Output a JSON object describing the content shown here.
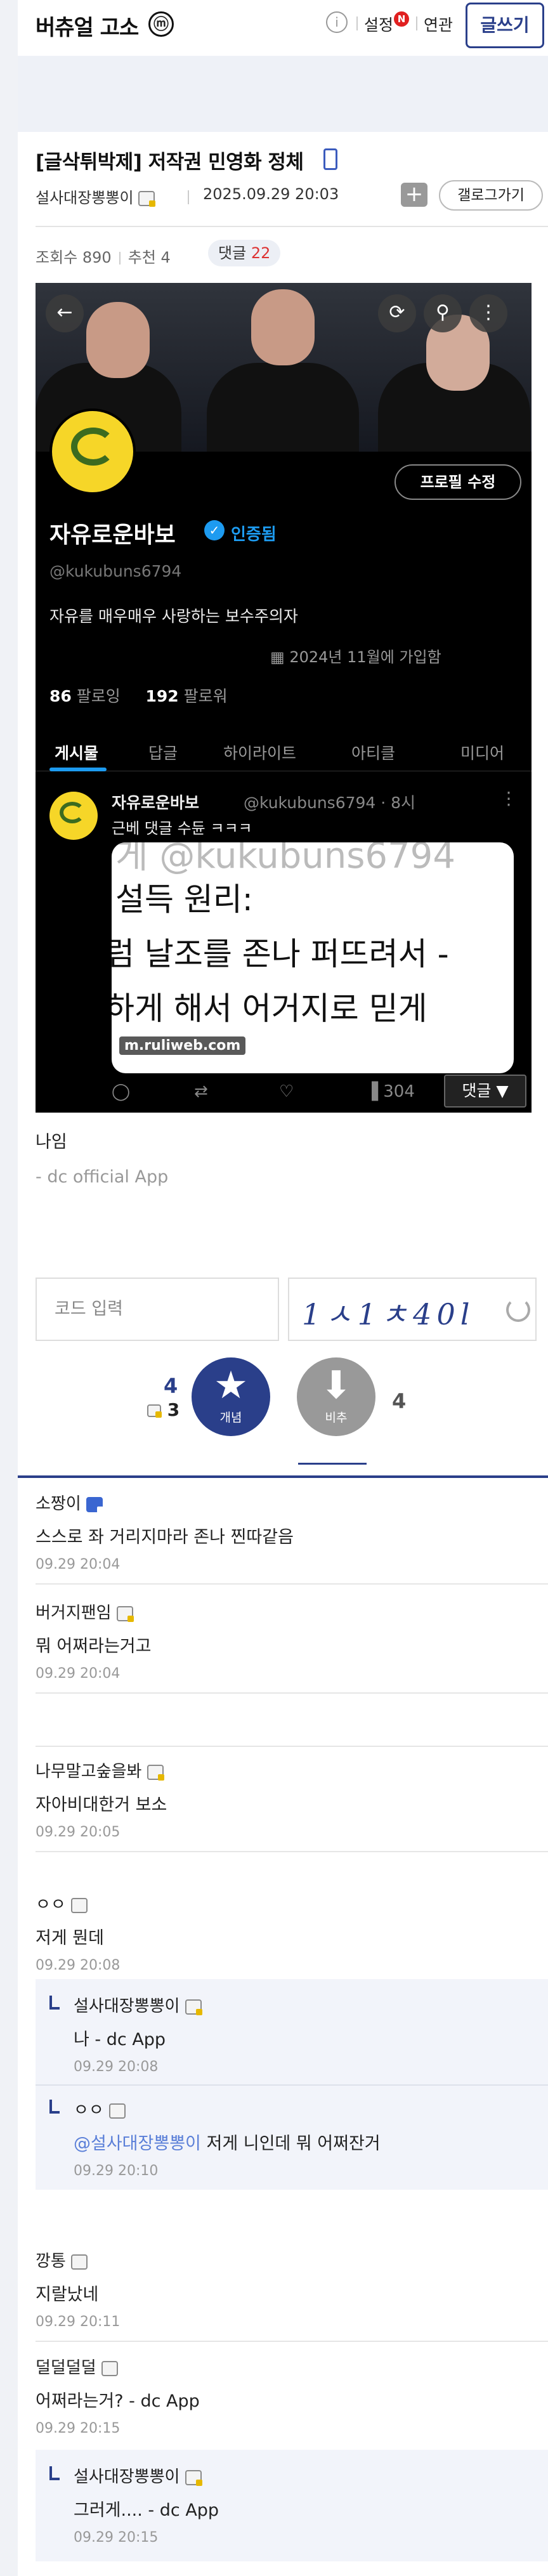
{
  "header": {
    "logo": "버츄얼 고소",
    "logo_badge": "ⓜ",
    "settings_label": "설정",
    "settings_badge": "N",
    "related_label": "연관",
    "write_button": "글쓰기"
  },
  "post": {
    "title": "[글삭튀박제] 저작권 민영화 정체",
    "author": "설사대장뽕뽕이",
    "date": "2025.09.29 20:03",
    "gallery_button": "갤로그가기",
    "views": "조회수 890",
    "recommends": "추천 4",
    "comments_label": "댓글",
    "comments_count": "22",
    "body_line1": "나임",
    "body_line2": "- dc official App"
  },
  "embedded_profile": {
    "edit_button": "프로필 수정",
    "name": "자유로운바보",
    "verified_label": "인증됨",
    "handle": "@kukubuns6794",
    "bio": "자유를 매우매우 사랑하는 보수주의자",
    "joined": "2024년 11월에 가입함",
    "following_count": "86",
    "following_label": "팔로잉",
    "followers_count": "192",
    "followers_label": "팔로워",
    "tabs": [
      "게시물",
      "답글",
      "하이라이트",
      "아티클",
      "미디어"
    ],
    "tweet": {
      "name": "자유로운바보",
      "meta": "@kukubuns6794 · 8시",
      "text": "근베 댓글 수듄 ㅋㅋㅋ",
      "image_ghost": "게 @kukubuns6794",
      "image_line1": "설득 원리:",
      "image_line2": "럼 날조를 존나 퍼뜨려서 -",
      "image_line3": "하게 해서 어거지로 믿게",
      "watermark": "m.ruliweb.com",
      "views": "304",
      "reply_dropdown": "댓글 ▼"
    }
  },
  "captcha": {
    "placeholder": "코드 입력",
    "code_image_text": "1ㅅ1ㅊ40l"
  },
  "votes": {
    "up_count": "4",
    "up_fixed_count": "3",
    "up_label": "개념",
    "down_label": "비추",
    "down_count": "4"
  },
  "comments": [
    {
      "nick": "소짱이",
      "text": "스스로 좌 거리지마라 존나 찐따같음",
      "time": "09.29 20:04"
    },
    {
      "nick": "버거지팬임",
      "text": "뭐 어쩌라는거고",
      "time": "09.29 20:04"
    },
    {
      "nick": "나무말고숲을봐",
      "text": "자아비대한거 보소",
      "time": "09.29 20:05"
    },
    {
      "nick": "ㅇㅇ",
      "text": "저게 뭔데",
      "time": "09.29 20:08"
    },
    {
      "nick": "설사대장뽕뽕이",
      "text": "나 - dc App",
      "time": "09.29 20:08"
    },
    {
      "nick": "ㅇㅇ",
      "mention": "@설사대장뽕뽕이",
      "text": " 저게 니인데 뭐 어쩌잔거",
      "time": "09.29 20:10"
    },
    {
      "nick": "깡통",
      "text": "지랄났네",
      "time": "09.29 20:11"
    },
    {
      "nick": "덜덜덜덜",
      "text": "어쩌라는거? - dc App",
      "time": "09.29 20:15"
    },
    {
      "nick": "설사대장뽕뽕이",
      "text": "그러게.... - dc App",
      "time": "09.29 20:15"
    }
  ]
}
